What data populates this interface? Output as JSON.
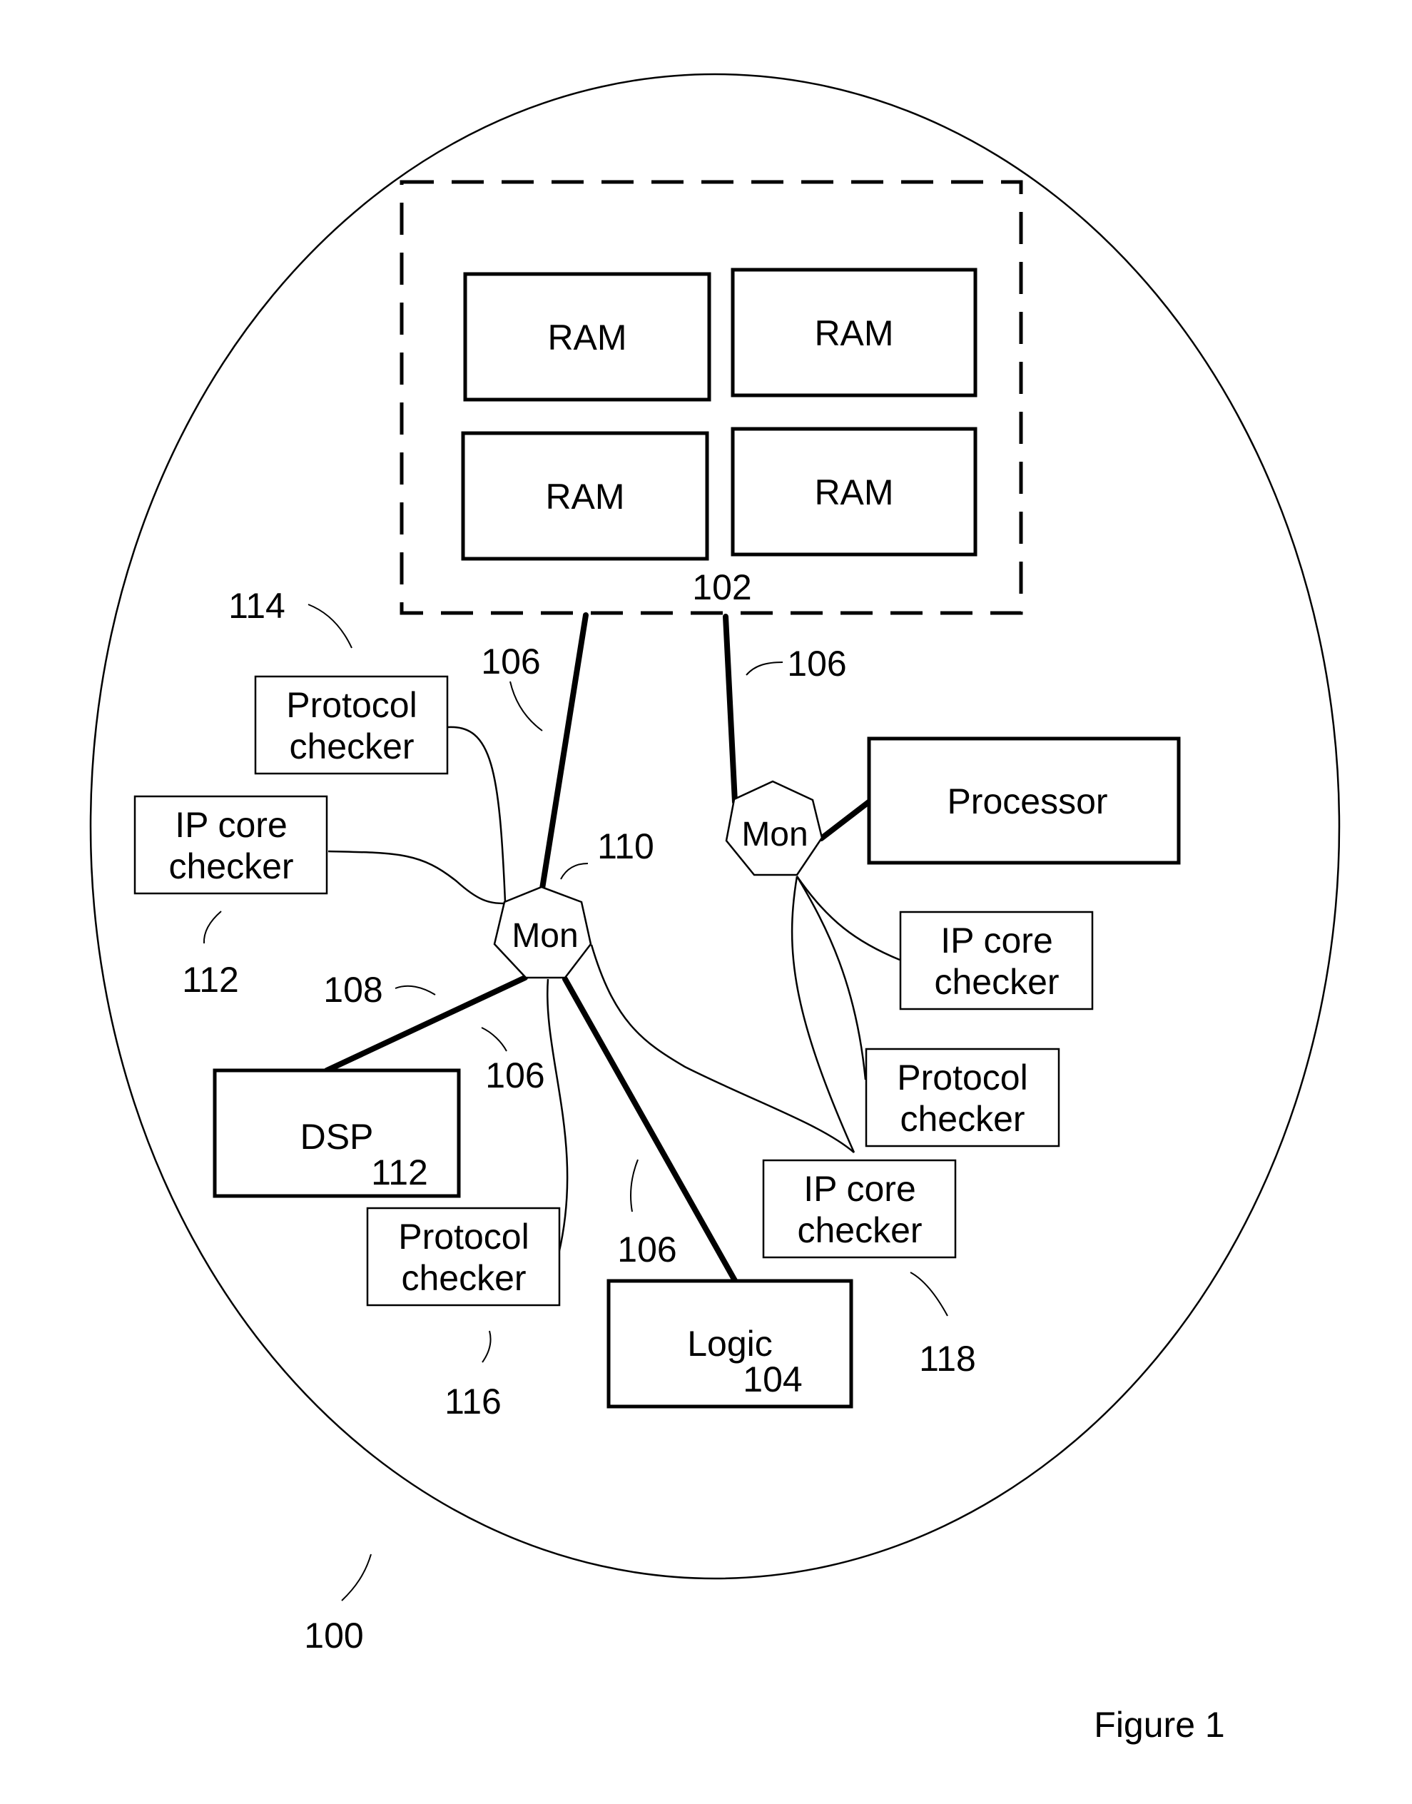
{
  "figure": {
    "caption": "Figure 1",
    "system_ref": "100"
  },
  "memory_block": {
    "ref": "102",
    "rams": [
      {
        "label": "RAM"
      },
      {
        "label": "RAM"
      },
      {
        "label": "RAM"
      },
      {
        "label": "RAM"
      }
    ]
  },
  "monitors": [
    {
      "label": "Mon",
      "ref": "110"
    },
    {
      "label": "Mon"
    }
  ],
  "components": {
    "processor": {
      "label": "Processor"
    },
    "dsp": {
      "label": "DSP",
      "ref": "112"
    },
    "logic": {
      "label": "Logic",
      "ref": "104"
    }
  },
  "checkers": {
    "protocol_114": {
      "line1": "Protocol",
      "line2": "checker",
      "ref": "114"
    },
    "ipcore_112": {
      "line1": "IP core",
      "line2": "checker",
      "ref": "112"
    },
    "protocol_116": {
      "line1": "Protocol",
      "line2": "checker",
      "ref": "116"
    },
    "ipcore_right": {
      "line1": "IP core",
      "line2": "checker"
    },
    "protocol_right": {
      "line1": "Protocol",
      "line2": "checker"
    },
    "ipcore_118": {
      "line1": "IP core",
      "line2": "checker",
      "ref": "118"
    }
  },
  "links": {
    "link_ref": "106",
    "dsp_link_ref": "108"
  }
}
